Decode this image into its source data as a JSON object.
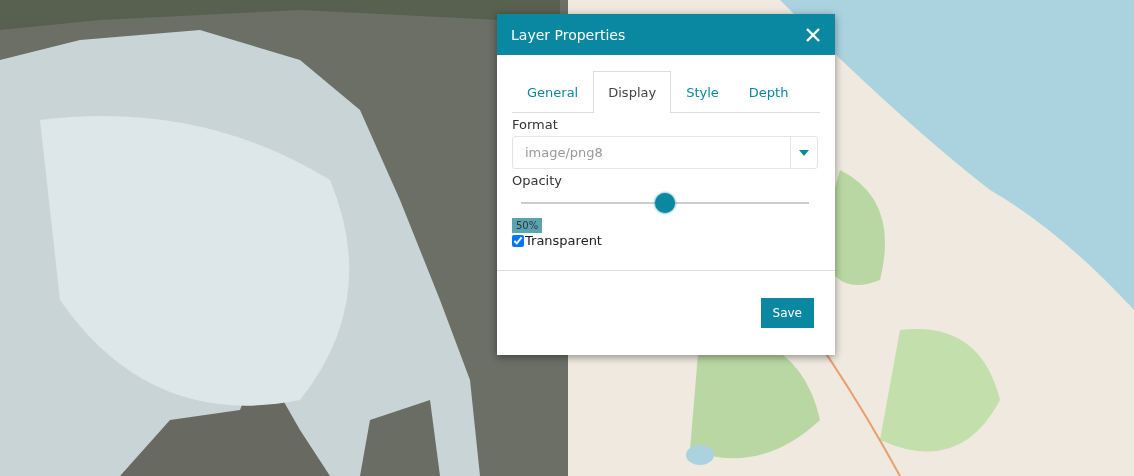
{
  "dialog": {
    "title": "Layer Properties",
    "tabs": [
      {
        "label": "General",
        "selected": false
      },
      {
        "label": "Display",
        "selected": true
      },
      {
        "label": "Style",
        "selected": false
      },
      {
        "label": "Depth",
        "selected": false
      }
    ],
    "format": {
      "label": "Format",
      "value": "image/png8"
    },
    "opacity": {
      "label": "Opacity",
      "level": 0.5,
      "reading": "50%"
    },
    "transparent": {
      "label": "Transparent",
      "checked": true
    },
    "buttons": [
      "Save"
    ]
  }
}
